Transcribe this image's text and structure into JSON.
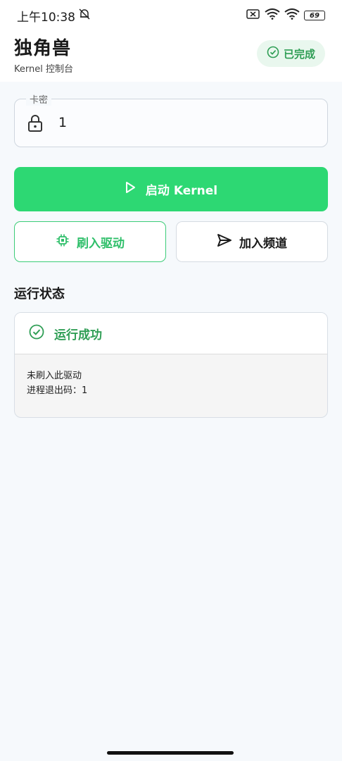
{
  "status_bar": {
    "time": "上午10:38",
    "battery": "69"
  },
  "header": {
    "title": "独角兽",
    "subtitle": "Kernel 控制台",
    "status_chip": "已完成"
  },
  "key_field": {
    "label": "卡密",
    "value": "1"
  },
  "actions": {
    "start_label": "启动 Kernel",
    "flash_label": "刷入驱动",
    "join_label": "加入频道"
  },
  "run_status": {
    "section_title": "运行状态",
    "result_title": "运行成功",
    "lines": [
      "未刷入此驱动",
      "进程退出码：1"
    ]
  },
  "colors": {
    "accent_green": "#2dd873",
    "success_green": "#2f9e55",
    "page_bg": "#f6f9fc"
  },
  "icons": [
    "mute-bell-icon",
    "sim-off-icon",
    "wifi-icon",
    "battery-icon",
    "check-circle-icon",
    "lock-icon",
    "play-icon",
    "chip-icon",
    "send-icon"
  ]
}
